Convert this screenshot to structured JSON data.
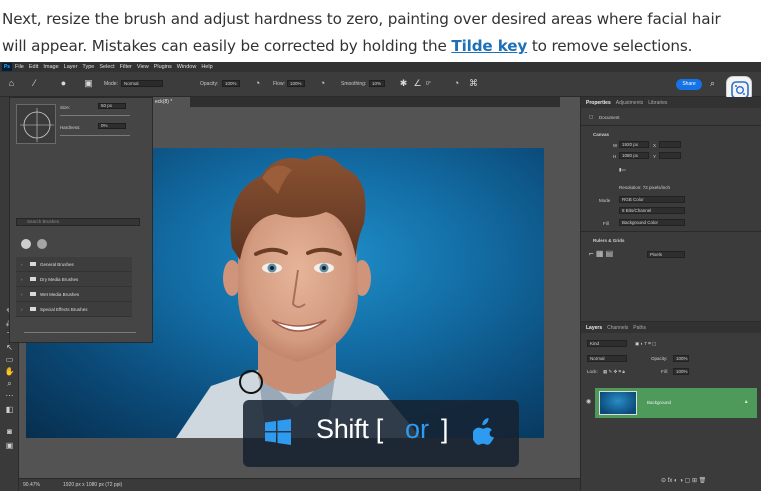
{
  "intro": {
    "line1": "Next, resize the brush and adjust hardness to zero, painting over desired areas where facial hair",
    "line2_before": "will appear. Mistakes can easily be corrected by holding the ",
    "link": "Tilde key",
    "line2_after": " to remove selections."
  },
  "menu": [
    "File",
    "Edit",
    "Image",
    "Layer",
    "Type",
    "Select",
    "Filter",
    "View",
    "Plugins",
    "Window",
    "Help"
  ],
  "options": {
    "mode_label": "Mode:",
    "mode_value": "Normal",
    "opacity_label": "Opacity:",
    "opacity_value": "100%",
    "flow_label": "Flow:",
    "flow_value": "100%",
    "smoothing_label": "Smoothing:",
    "smoothing_value": "10%",
    "angle_value": "0°",
    "share": "Share"
  },
  "doc_tab": "eck(8) *",
  "brush_panel": {
    "size_label": "Size:",
    "size_value": "50 px",
    "hardness_label": "Hardness:",
    "hardness_value": "0%",
    "search_placeholder": "Search Brushes",
    "folders": [
      "General Brushes",
      "Dry Media Brushes",
      "Wet Media Brushes",
      "Special Effects Brushes"
    ]
  },
  "right_panel": {
    "tabs": [
      "Properties",
      "Adjustments",
      "Libraries"
    ],
    "document": "Document",
    "canvas": "Canvas",
    "w_label": "W",
    "w_value": "1920 px",
    "h_label": "H",
    "h_value": "1080 px",
    "x_label": "X",
    "y_label": "Y",
    "resolution": "Resolution: 72 pixels/inch",
    "mode_label": "Mode",
    "mode_value": "RGB Color",
    "depth_value": "8 Bits/Channel",
    "fill_label": "Fill",
    "fill_value": "Background Color",
    "rulers": "Rulers & Grids",
    "units": "Pixels",
    "layer_tabs": [
      "Layers",
      "Channels",
      "Paths"
    ],
    "kind": "Kind",
    "blend": "Normal",
    "opacity": "Opacity:",
    "opacity_value": "100%",
    "lock": "Lock:",
    "fill2": "Fill:",
    "fill2_value": "100%",
    "layer_name": "Background"
  },
  "status": {
    "zoom": "90.47%",
    "dims": "1920 px x 1080 px (72 ppi)"
  },
  "overlay": {
    "shift": "Shift",
    "open_bracket": "[",
    "or": "or",
    "close_bracket": "]"
  }
}
